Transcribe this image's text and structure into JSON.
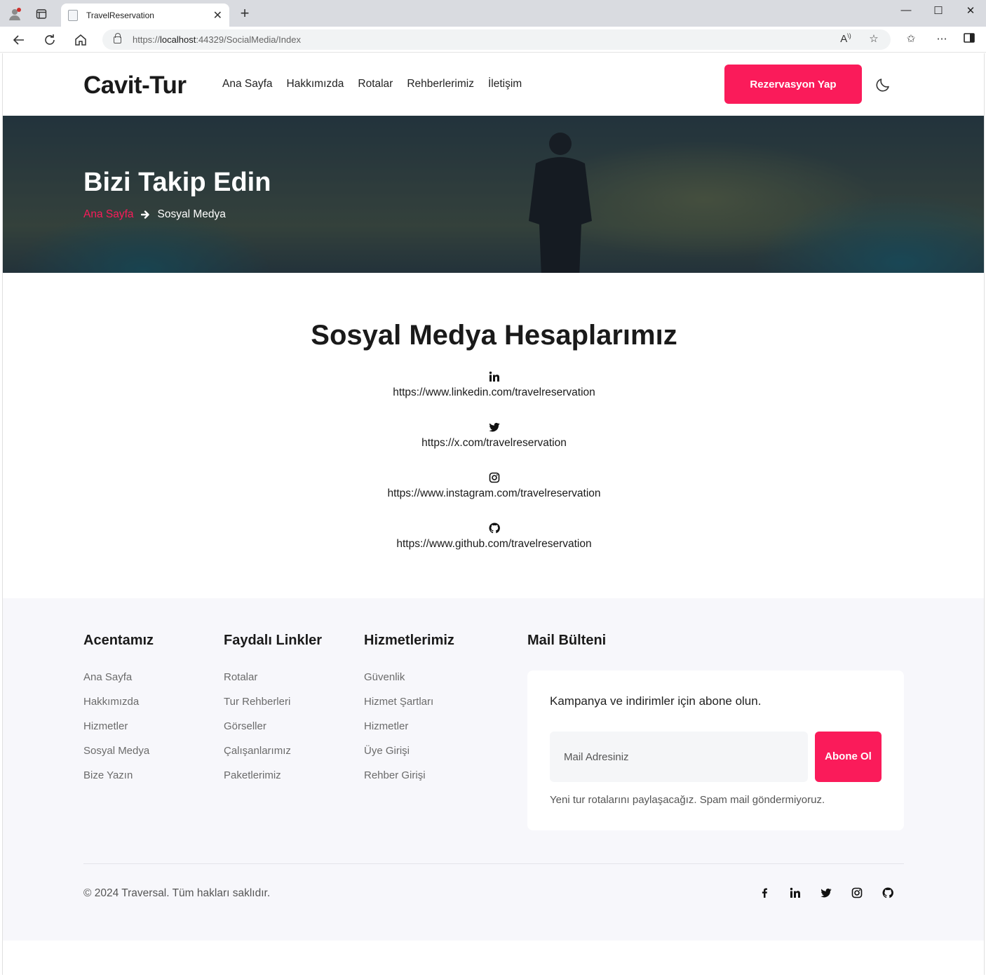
{
  "browser": {
    "tab_title": "TravelReservation",
    "url_prefix": "https://",
    "url_host": "localhost",
    "url_rest": ":44329/SocialMedia/Index"
  },
  "header": {
    "brand": "Cavit-Tur",
    "menu": [
      "Ana Sayfa",
      "Hakkımızda",
      "Rotalar",
      "Rehberlerimiz",
      "İletişim"
    ],
    "cta_label": "Rezervasyon Yap",
    "theme_icon": "moon-icon"
  },
  "hero": {
    "title": "Bizi Takip Edin",
    "breadcrumb_home": "Ana Sayfa",
    "breadcrumb_current": "Sosyal Medya"
  },
  "social": {
    "heading": "Sosyal Medya Hesaplarımız",
    "items": [
      {
        "icon": "linkedin-icon",
        "url": "https://www.linkedin.com/travelreservation"
      },
      {
        "icon": "twitter-icon",
        "url": "https://x.com/travelreservation"
      },
      {
        "icon": "instagram-icon",
        "url": "https://www.instagram.com/travelreservation"
      },
      {
        "icon": "github-icon",
        "url": "https://www.github.com/travelreservation"
      }
    ]
  },
  "footer": {
    "columns": [
      {
        "title": "Acentamız",
        "links": [
          "Ana Sayfa",
          "Hakkımızda",
          "Hizmetler",
          "Sosyal Medya",
          "Bize Yazın"
        ]
      },
      {
        "title": "Faydalı Linkler",
        "links": [
          "Rotalar",
          "Tur Rehberleri",
          "Görseller",
          "Çalışanlarımız",
          "Paketlerimiz"
        ]
      },
      {
        "title": "Hizmetlerimiz",
        "links": [
          "Güvenlik",
          "Hizmet Şartları",
          "Hizmetler",
          "Üye Girişi",
          "Rehber Girişi"
        ]
      }
    ],
    "newsletter": {
      "title": "Mail Bülteni",
      "text": "Kampanya ve indirimler için abone olun.",
      "placeholder": "Mail Adresiniz",
      "button": "Abone Ol",
      "note": "Yeni tur rotalarını paylaşacağız. Spam mail göndermiyoruz."
    },
    "copyright": "© 2024 Traversal. Tüm hakları saklıdır.",
    "social_icons": [
      "facebook-icon",
      "linkedin-icon",
      "twitter-icon",
      "instagram-icon",
      "github-icon"
    ]
  },
  "colors": {
    "accent": "#fa1b5a",
    "footer_bg": "#f7f7fb"
  }
}
